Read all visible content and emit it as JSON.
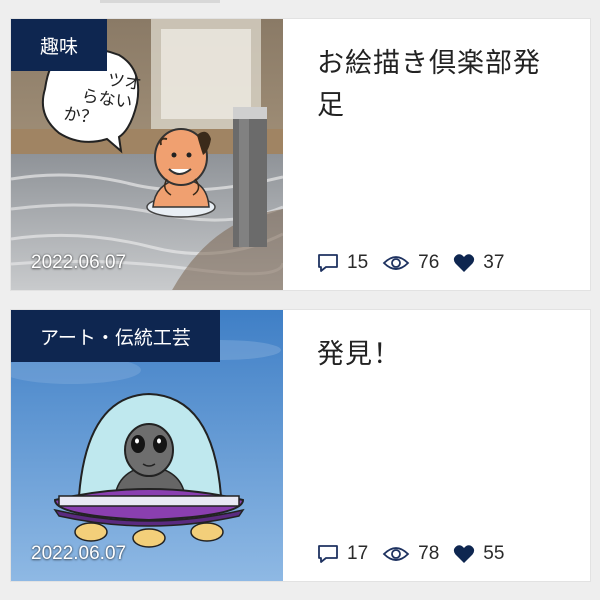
{
  "posts": [
    {
      "category": "趣味",
      "title": "お絵描き倶楽部発足",
      "date": "2022.06.07",
      "speech_bubble": "ツオらないか？",
      "stats": {
        "comments": "15",
        "views": "76",
        "likes": "37"
      }
    },
    {
      "category": "アート・伝統工芸",
      "title": "発見！",
      "date": "2022.06.07",
      "stats": {
        "comments": "17",
        "views": "78",
        "likes": "55"
      }
    }
  ],
  "colors": {
    "badge_bg": "#0e2650",
    "heart": "#0e2650",
    "card_bg": "#ffffff",
    "page_bg": "#eeeeee"
  },
  "icons": [
    "comment-icon",
    "eye-icon",
    "heart-icon"
  ]
}
